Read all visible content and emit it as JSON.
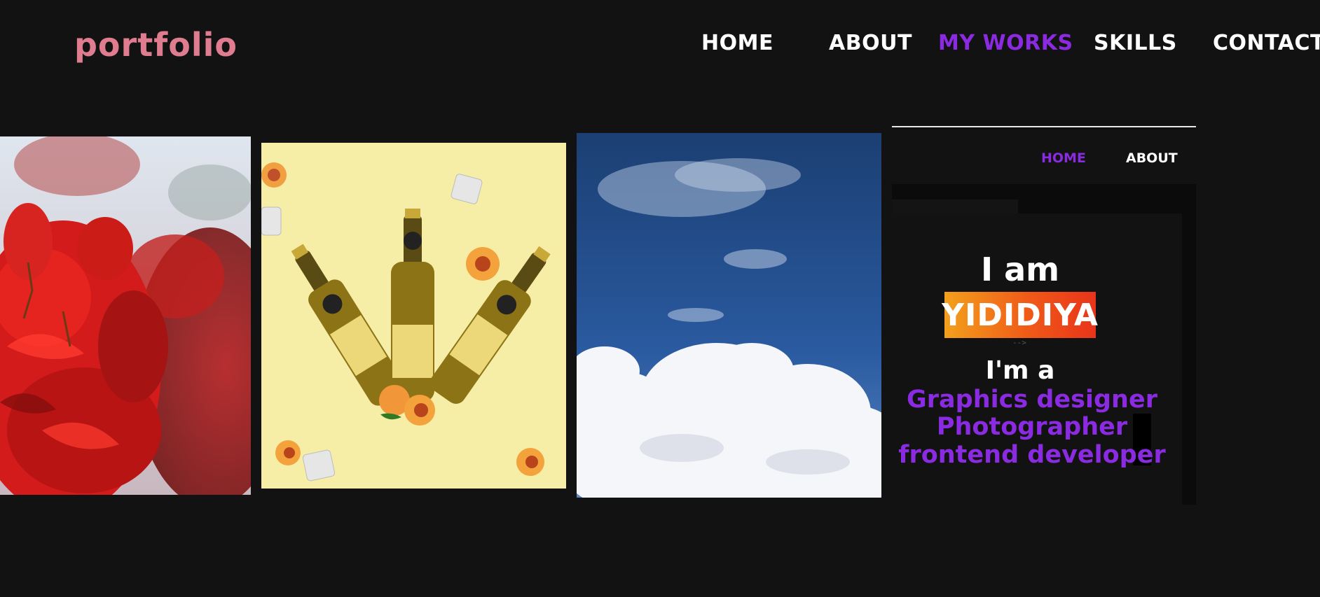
{
  "header": {
    "logo": "portfolio",
    "nav": [
      {
        "label": "HOME",
        "active": false
      },
      {
        "label": "ABOUT",
        "active": false
      },
      {
        "label": "MY WORKS",
        "active": true
      },
      {
        "label": "SKILLS",
        "active": false
      },
      {
        "label": "CONTACT",
        "active": false
      }
    ]
  },
  "works": [
    {
      "name": "red-flowers-photo"
    },
    {
      "name": "beer-bottles-design"
    },
    {
      "name": "sky-clouds-photo"
    }
  ],
  "preview": {
    "nav": [
      {
        "label": "HOME",
        "active": true
      },
      {
        "label": "ABOUT",
        "active": false
      }
    ],
    "intro": "I am",
    "name": "YIDIDIYA",
    "arrow": "-->",
    "im_a": "I'm a",
    "roles": [
      "Graphics designer",
      "Photographer",
      "frontend developer"
    ]
  },
  "colors": {
    "background": "#121212",
    "logo": "#e07c8f",
    "accent": "#8a2be2",
    "text": "#ffffff"
  }
}
